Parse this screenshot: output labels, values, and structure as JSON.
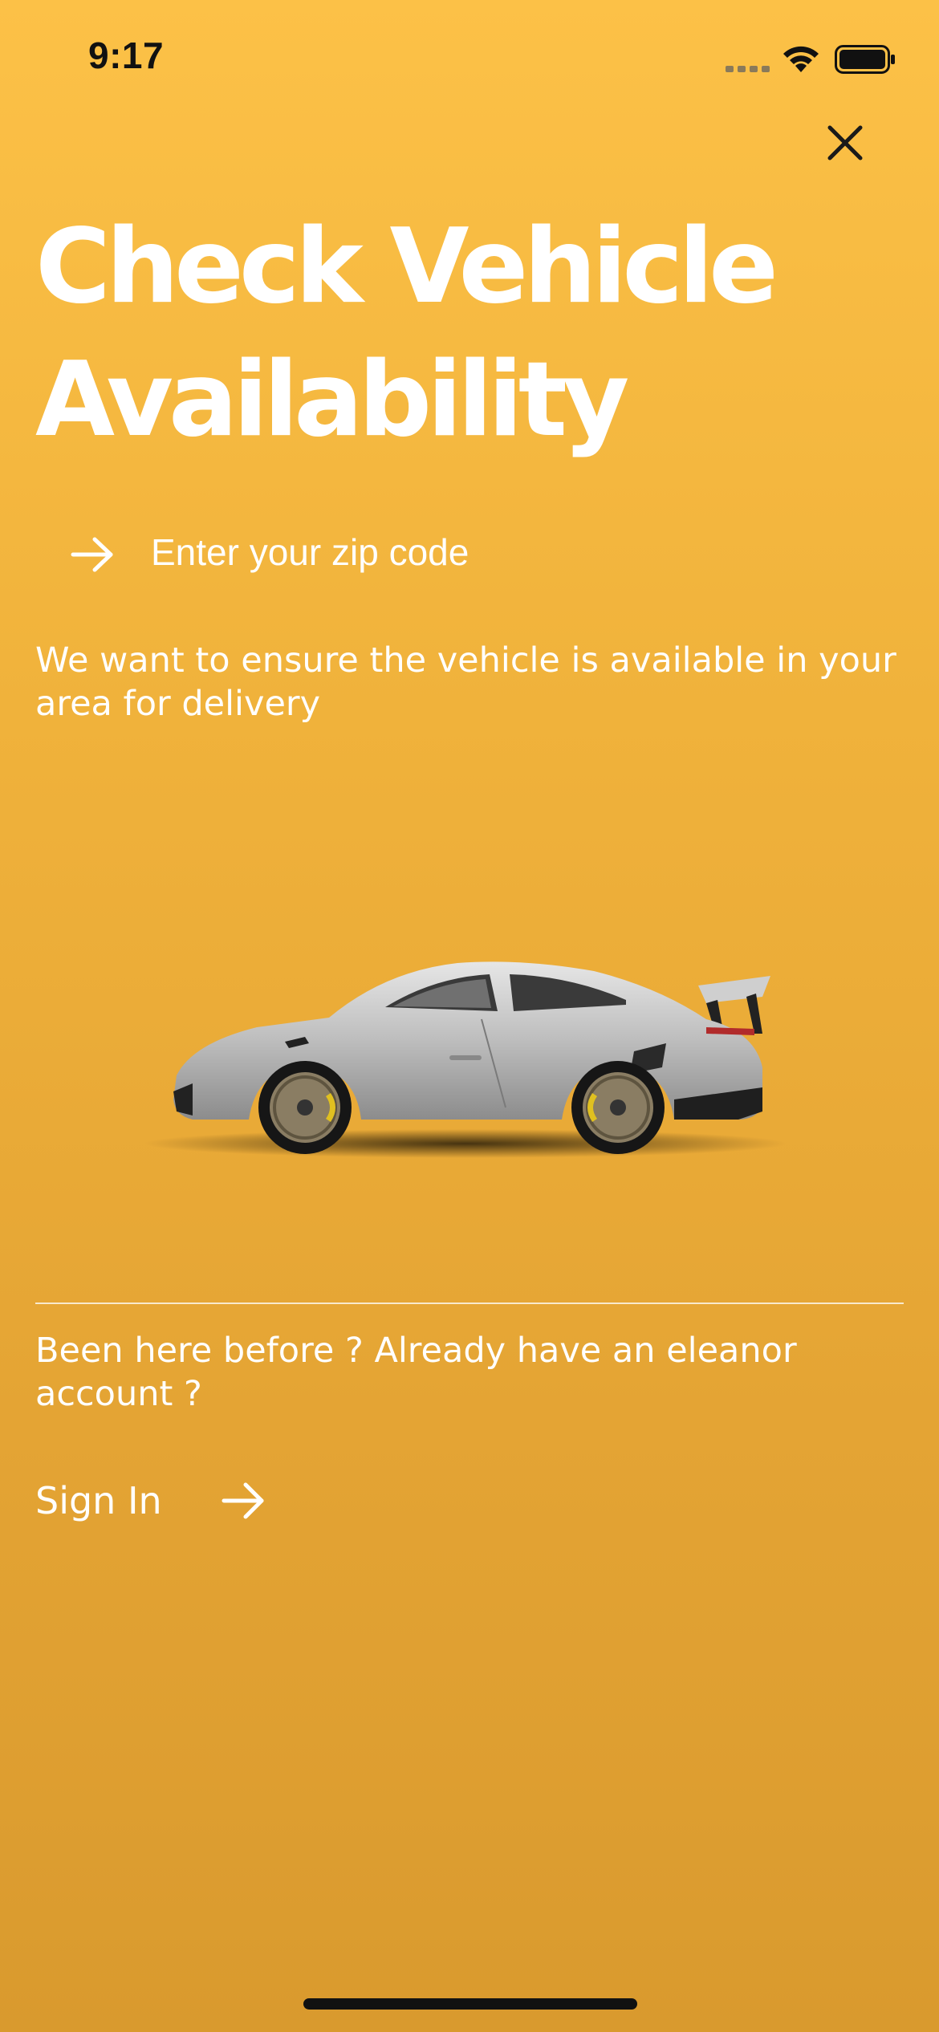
{
  "status_bar": {
    "time": "9:17",
    "icons": [
      "cellular-signal-icon",
      "wifi-icon",
      "battery-icon"
    ]
  },
  "header": {
    "close_icon": "close-icon",
    "title": "Check Vehicle Availability"
  },
  "zip": {
    "icon": "arrow-right-icon",
    "placeholder": "Enter your zip code",
    "value": ""
  },
  "helper_text": "We want to ensure the vehicle is available in your area for delivery",
  "hero": {
    "image": "sports-car-image"
  },
  "account": {
    "prompt": "Been here before ? Already have an eleanor account ?",
    "sign_in_label": "Sign In",
    "sign_in_icon": "arrow-right-icon"
  },
  "colors": {
    "background_top": "#fcc147",
    "background_bottom": "#d99a2e",
    "text": "#ffffff",
    "status_text": "#111111"
  }
}
